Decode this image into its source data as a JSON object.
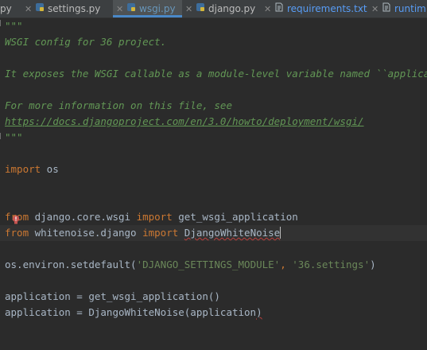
{
  "tabs": [
    {
      "label": "py",
      "active": false,
      "icon": "none"
    },
    {
      "label": "settings.py",
      "active": false,
      "icon": "python-file-icon"
    },
    {
      "label": "wsgi.py",
      "active": true,
      "icon": "python-file-icon"
    },
    {
      "label": "django.py",
      "active": false,
      "icon": "python-file-icon"
    },
    {
      "label": "requirements.txt",
      "active": false,
      "icon": "text-file-icon"
    },
    {
      "label": "runtim",
      "active": false,
      "icon": "text-file-icon"
    }
  ],
  "code": {
    "doc_open": "\"\"\"",
    "doc_line1": "WSGI config for 36 project.",
    "doc_line2": "It exposes the WSGI callable as a module-level variable named ``application``.",
    "doc_line3": "For more information on this file, see",
    "doc_link": "https://docs.djangoproject.com/en/3.0/howto/deployment/wsgi/",
    "doc_close": "\"\"\"",
    "import_kw": "import",
    "import_mod": " os",
    "from1_kw": "from",
    "from1_mod": " django.core.wsgi ",
    "from1_import_kw": "import",
    "from1_name": " get_wsgi_application",
    "from2_kw": "from",
    "from2_mod": " whitenoise.django ",
    "from2_import_kw": "import",
    "from2_space": " ",
    "from2_name": "DjangoWhiteNoise",
    "setdefault_pre": "os.environ.setdefault(",
    "setdefault_arg1": "'DJANGO_SETTINGS_MODULE'",
    "setdefault_sep": ", ",
    "setdefault_arg2": "'36.settings'",
    "setdefault_post": ")",
    "app_line1": "application = get_wsgi_application()",
    "app_line2_pre": "application = DjangoWhiteNoise(application",
    "app_line2_post": ")"
  },
  "colors": {
    "background": "#2b2b2b",
    "keyword": "#cc7832",
    "string": "#6a8759",
    "docstring": "#629755",
    "text": "#a9b7c6",
    "active_tab_underline": "#4a88c7"
  }
}
